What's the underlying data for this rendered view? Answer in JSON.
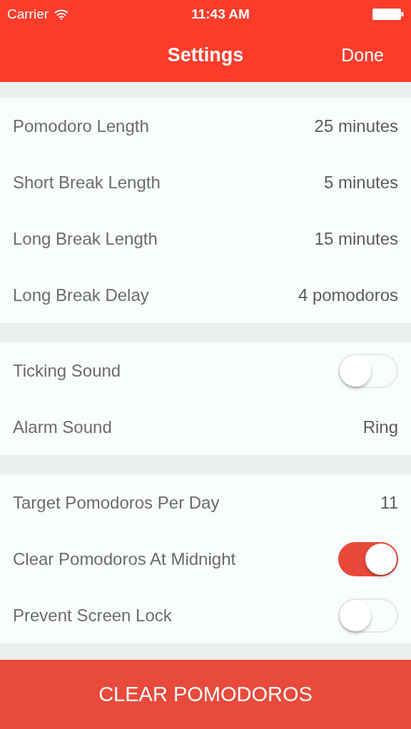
{
  "status_bar": {
    "carrier": "Carrier",
    "time": "11:43 AM"
  },
  "nav_bar": {
    "title": "Settings",
    "done": "Done"
  },
  "sections": [
    {
      "rows": [
        {
          "kind": "value",
          "label": "Pomodoro Length",
          "value": "25 minutes"
        },
        {
          "kind": "value",
          "label": "Short Break Length",
          "value": "5 minutes"
        },
        {
          "kind": "value",
          "label": "Long Break Length",
          "value": "15 minutes"
        },
        {
          "kind": "value",
          "label": "Long Break Delay",
          "value": "4 pomodoros"
        }
      ]
    },
    {
      "rows": [
        {
          "kind": "switch",
          "label": "Ticking Sound",
          "on": false
        },
        {
          "kind": "value",
          "label": "Alarm Sound",
          "value": "Ring"
        }
      ]
    },
    {
      "rows": [
        {
          "kind": "value",
          "label": "Target Pomodoros Per Day",
          "value": "11"
        },
        {
          "kind": "switch",
          "label": "Clear Pomodoros At Midnight",
          "on": true
        },
        {
          "kind": "switch",
          "label": "Prevent Screen Lock",
          "on": false
        }
      ]
    }
  ],
  "clear_button": "CLEAR POMODOROS"
}
